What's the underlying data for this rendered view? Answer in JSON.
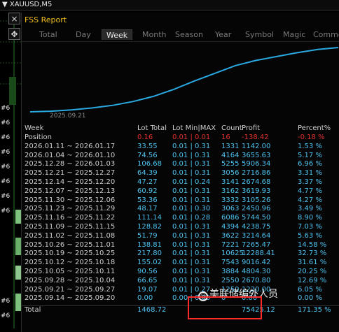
{
  "symbol_bar": {
    "symbol": "▼ XAUUSD,M5"
  },
  "toolbar": {
    "close_glyph": "×",
    "move_glyph": "✥"
  },
  "left_labels": [
    "#6",
    "#6",
    "#6",
    "#6",
    "#6",
    "#6",
    "#6",
    "#6",
    "#6",
    "#6"
  ],
  "window": {
    "title": "FSS Report",
    "tabs": [
      "Total",
      "Day",
      "Week",
      "Month",
      "Season",
      "Year",
      "Symbol",
      "Magic",
      "Commen"
    ],
    "active_tab": "Week"
  },
  "equity_curve": {
    "start_date_label": "2025.09.21",
    "points": [
      0.0,
      0.01,
      0.03,
      0.06,
      0.1,
      0.16,
      0.24,
      0.35,
      0.48,
      0.6,
      0.72,
      0.8,
      0.86,
      0.92,
      0.97,
      1.0
    ],
    "color": "#2aa8e0"
  },
  "table": {
    "headers": {
      "week": "Week",
      "lot_total": "Lot Total",
      "lot_minmax": "Lot Min|MAX",
      "count": "Count",
      "profit": "Profit",
      "percent": "Percent%"
    },
    "rows": [
      {
        "week": "Position",
        "lot": "0.16",
        "minmax": "0.01 | 0.01",
        "count": "16",
        "profit": "-138.42",
        "pct": "-0.18 %",
        "negative": true
      },
      {
        "week": "2026.01.11 ~ 2026.01.17",
        "lot": "33.55",
        "minmax": "0.01 | 0.31",
        "count": "1331",
        "profit": "1142.00",
        "pct": "1.53 %"
      },
      {
        "week": "2026.01.04 ~ 2026.01.10",
        "lot": "74.56",
        "minmax": "0.01 | 0.31",
        "count": "4164",
        "profit": "3655.63",
        "pct": "5.17 %"
      },
      {
        "week": "2025.12.28 ~ 2026.01.03",
        "lot": "106.68",
        "minmax": "0.01 | 0.31",
        "count": "5255",
        "profit": "5906.34",
        "pct": "6.96 %"
      },
      {
        "week": "2025.12.21 ~ 2025.12.27",
        "lot": "64.39",
        "minmax": "0.01 | 0.31",
        "count": "3056",
        "profit": "2716.86",
        "pct": "3.31 %"
      },
      {
        "week": "2025.12.14 ~ 2025.12.20",
        "lot": "47.27",
        "minmax": "0.01 | 0.24",
        "count": "3141",
        "profit": "2674.68",
        "pct": "3.37 %"
      },
      {
        "week": "2025.12.07 ~ 2025.12.13",
        "lot": "60.92",
        "minmax": "0.01 | 0.31",
        "count": "3162",
        "profit": "3619.93",
        "pct": "4.77 %"
      },
      {
        "week": "2025.11.30 ~ 2025.12.06",
        "lot": "53.36",
        "minmax": "0.01 | 0.31",
        "count": "3332",
        "profit": "3105.26",
        "pct": "4.27 %"
      },
      {
        "week": "2025.11.23 ~ 2025.11.29",
        "lot": "48.17",
        "minmax": "0.01 | 0.30",
        "count": "3063",
        "profit": "2450.96",
        "pct": "3.49 %"
      },
      {
        "week": "2025.11.16 ~ 2025.11.22",
        "lot": "111.14",
        "minmax": "0.01 | 0.28",
        "count": "6086",
        "profit": "5744.50",
        "pct": "8.90 %"
      },
      {
        "week": "2025.11.09 ~ 2025.11.15",
        "lot": "128.82",
        "minmax": "0.01 | 0.31",
        "count": "4394",
        "profit": "4238.75",
        "pct": "7.03 %"
      },
      {
        "week": "2025.11.02 ~ 2025.11.08",
        "lot": "51.79",
        "minmax": "0.01 | 0.31",
        "count": "3622",
        "profit": "3214.64",
        "pct": "5.63 %"
      },
      {
        "week": "2025.10.26 ~ 2025.11.01",
        "lot": "138.81",
        "minmax": "0.01 | 0.31",
        "count": "7221",
        "profit": "7265.47",
        "pct": "14.58 %"
      },
      {
        "week": "2025.10.19 ~ 2025.10.25",
        "lot": "217.80",
        "minmax": "0.01 | 0.31",
        "count": "10625",
        "profit": "12288.41",
        "pct": "32.73 %"
      },
      {
        "week": "2025.10.12 ~ 2025.10.18",
        "lot": "155.02",
        "minmax": "0.01 | 0.31",
        "count": "7543",
        "profit": "9016.42",
        "pct": "31.61 %"
      },
      {
        "week": "2025.10.05 ~ 2025.10.11",
        "lot": "90.56",
        "minmax": "0.01 | 0.31",
        "count": "3884",
        "profit": "4804.30",
        "pct": "20.25 %"
      },
      {
        "week": "2025.09.28 ~ 2025.10.04",
        "lot": "66.65",
        "minmax": "0.01 | 0.31",
        "count": "2550",
        "profit": "2670.80",
        "pct": "12.69 %"
      },
      {
        "week": "2025.09.21 ~ 2025.09.27",
        "lot": "19.07",
        "minmax": "0.01 | 0.27",
        "count": "1250",
        "profit": "1220.00",
        "pct": "6.05 %"
      },
      {
        "week": "2025.09.14 ~ 2025.09.20",
        "lot": "0.00",
        "minmax": "0.00 | 0.00",
        "count": "0",
        "profit": "0.00",
        "pct": "0.00 %"
      }
    ],
    "total": {
      "week": "Total",
      "lot": "1468.72",
      "minmax": "",
      "count": "",
      "profit": "75425.12",
      "pct": "171.35 %"
    }
  },
  "watermark": {
    "icon": "◎",
    "text": "美联储编外人员"
  },
  "colors": {
    "value_text": "#4fc3f0",
    "negative": "#e03030",
    "title": "#f0c020",
    "highlight_box": "#ff2a2a"
  }
}
